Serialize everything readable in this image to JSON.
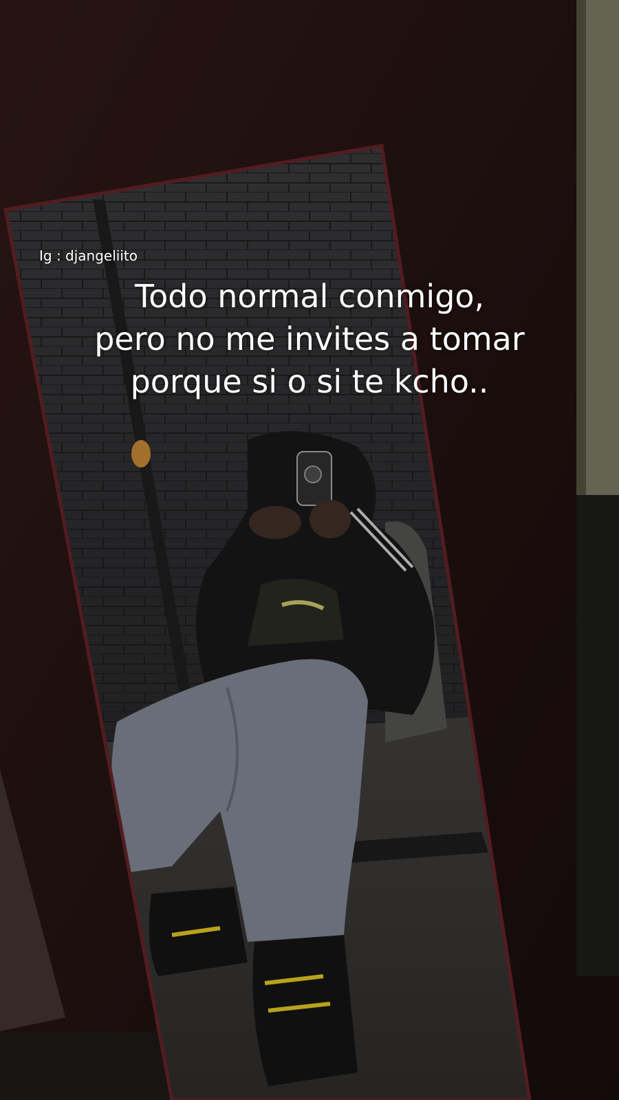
{
  "overlay": {
    "handle": "Ig : djangeliito",
    "caption_lines": [
      "Todo normal conmigo,",
      "pero no me invites a tomar",
      "porque si o si te kcho.."
    ]
  },
  "colors": {
    "background_wood": "#2a1512",
    "mirror_frame": "#5a1f24",
    "brick_wall": "#2c2c2e",
    "jeans": "#7a808c",
    "shoe_accent": "#c8b020",
    "text": "#ffffff"
  },
  "photo": {
    "subject": "mirror-selfie"
  }
}
